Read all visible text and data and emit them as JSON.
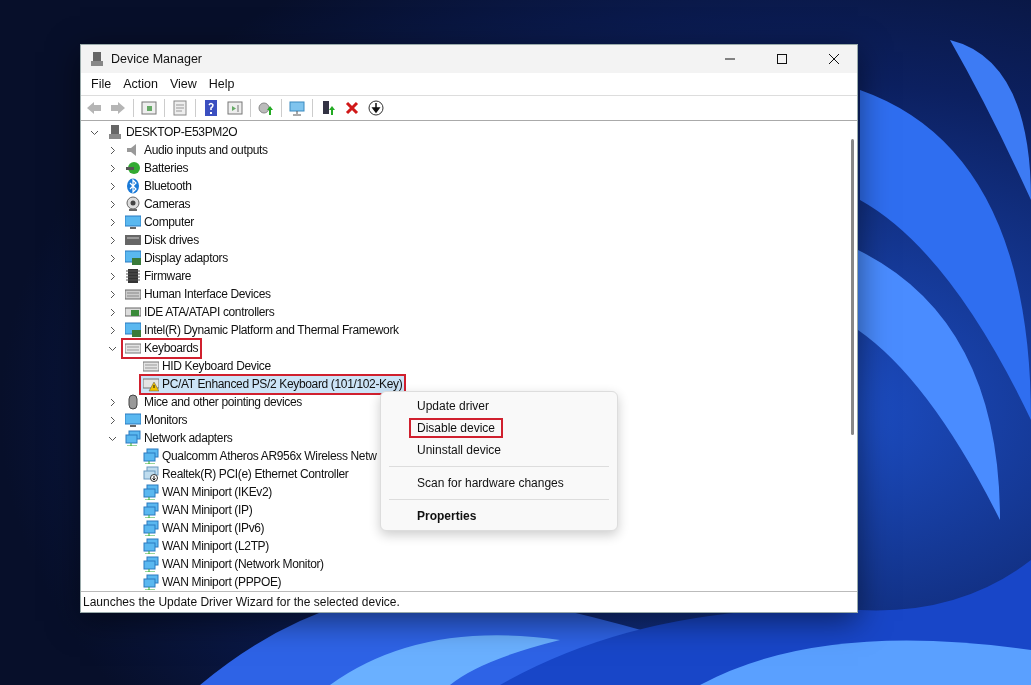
{
  "window": {
    "title": "Device Manager"
  },
  "menu_bar": [
    "File",
    "Action",
    "View",
    "Help"
  ],
  "toolbar": [
    {
      "kind": "back"
    },
    {
      "kind": "forward"
    },
    {
      "kind": "separator"
    },
    {
      "kind": "console-tree"
    },
    {
      "kind": "separator"
    },
    {
      "kind": "properties"
    },
    {
      "kind": "separator"
    },
    {
      "kind": "help"
    },
    {
      "kind": "action-pane"
    },
    {
      "kind": "separator"
    },
    {
      "kind": "update-driver"
    },
    {
      "kind": "separator"
    },
    {
      "kind": "scan"
    },
    {
      "kind": "separator"
    },
    {
      "kind": "enable"
    },
    {
      "kind": "uninstall"
    },
    {
      "kind": "disable"
    }
  ],
  "tree": {
    "label": "DESKTOP-E53PM2O",
    "kind": "computer-root",
    "expanded": true,
    "selected": false,
    "children": [
      {
        "label": "Audio inputs and outputs",
        "kind": "audio",
        "expanded": false,
        "selected": false,
        "annotated": false
      },
      {
        "label": "Batteries",
        "kind": "battery",
        "expanded": false,
        "selected": false,
        "annotated": false
      },
      {
        "label": "Bluetooth",
        "kind": "bluetooth",
        "expanded": false,
        "selected": false,
        "annotated": false
      },
      {
        "label": "Cameras",
        "kind": "camera",
        "expanded": false,
        "selected": false,
        "annotated": false
      },
      {
        "label": "Computer",
        "kind": "monitor",
        "expanded": false,
        "selected": false,
        "annotated": false
      },
      {
        "label": "Disk drives",
        "kind": "disk",
        "expanded": false,
        "selected": false,
        "annotated": false
      },
      {
        "label": "Display adaptors",
        "kind": "display",
        "expanded": false,
        "selected": false,
        "annotated": false
      },
      {
        "label": "Firmware",
        "kind": "chip",
        "expanded": false,
        "selected": false,
        "annotated": false
      },
      {
        "label": "Human Interface Devices",
        "kind": "hid",
        "expanded": false,
        "selected": false,
        "annotated": false
      },
      {
        "label": "IDE ATA/ATAPI controllers",
        "kind": "ide",
        "expanded": false,
        "selected": false,
        "annotated": false
      },
      {
        "label": "Intel(R) Dynamic Platform and Thermal Framework",
        "kind": "display",
        "expanded": false,
        "selected": false,
        "annotated": false
      },
      {
        "label": "Keyboards",
        "kind": "keyboard",
        "expanded": true,
        "selected": false,
        "annotated": true,
        "children": [
          {
            "label": "HID Keyboard Device",
            "kind": "keyboard",
            "selected": false,
            "annotated": false
          },
          {
            "label": "PC/AT Enhanced PS/2 Keyboard (101/102-Key)",
            "kind": "keyboard-warning",
            "selected": true,
            "annotated": true
          }
        ]
      },
      {
        "label": "Mice and other pointing devices",
        "kind": "mouse",
        "expanded": false,
        "selected": false,
        "annotated": false
      },
      {
        "label": "Monitors",
        "kind": "monitor",
        "expanded": false,
        "selected": false,
        "annotated": false
      },
      {
        "label": "Network adapters",
        "kind": "network",
        "expanded": true,
        "selected": false,
        "annotated": false,
        "children": [
          {
            "label": "Qualcomm Atheros AR956x Wireless Netw",
            "kind": "network",
            "selected": false,
            "annotated": false
          },
          {
            "label": "Realtek(R) PCI(e) Ethernet Controller",
            "kind": "network-down",
            "selected": false,
            "annotated": false
          },
          {
            "label": "WAN Miniport (IKEv2)",
            "kind": "network",
            "selected": false,
            "annotated": false
          },
          {
            "label": "WAN Miniport (IP)",
            "kind": "network",
            "selected": false,
            "annotated": false
          },
          {
            "label": "WAN Miniport (IPv6)",
            "kind": "network",
            "selected": false,
            "annotated": false
          },
          {
            "label": "WAN Miniport (L2TP)",
            "kind": "network",
            "selected": false,
            "annotated": false
          },
          {
            "label": "WAN Miniport (Network Monitor)",
            "kind": "network",
            "selected": false,
            "annotated": false
          },
          {
            "label": "WAN Miniport (PPPOE)",
            "kind": "network",
            "selected": false,
            "annotated": false
          }
        ]
      }
    ]
  },
  "context_menu": [
    [
      {
        "label": "Update driver",
        "default": false,
        "annotated": false
      },
      {
        "label": "Disable device",
        "default": false,
        "annotated": true
      },
      {
        "label": "Uninstall device",
        "default": false,
        "annotated": false
      }
    ],
    [
      {
        "label": "Scan for hardware changes",
        "default": false,
        "annotated": false
      }
    ],
    [
      {
        "label": "Properties",
        "default": true,
        "annotated": false
      }
    ]
  ],
  "status_bar": "Launches the Update Driver Wizard for the selected device."
}
